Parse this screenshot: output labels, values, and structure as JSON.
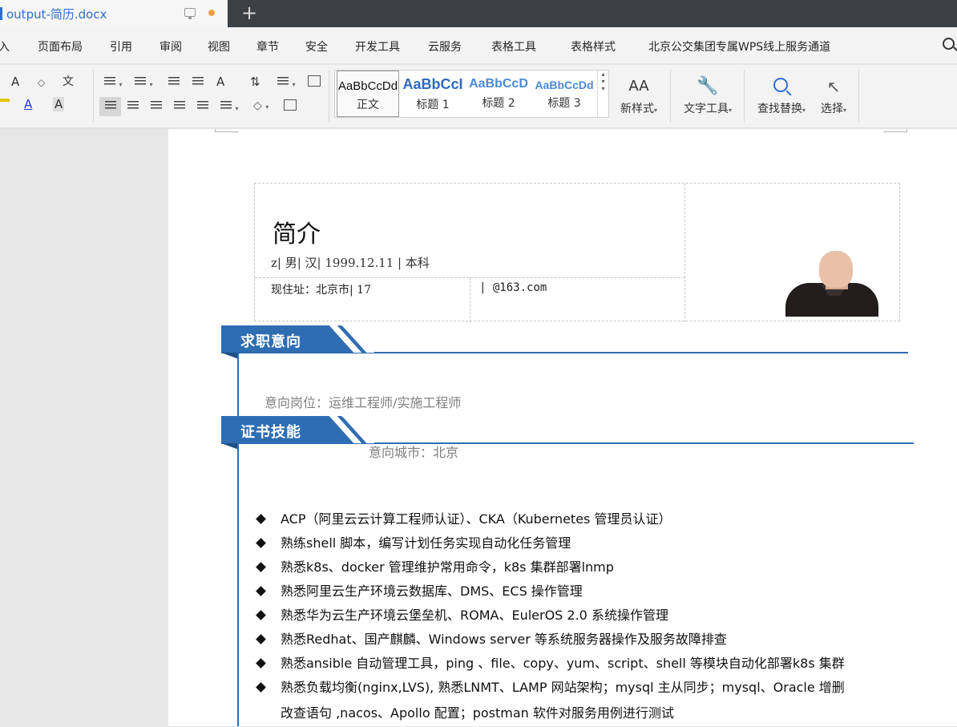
{
  "window": {
    "tab_title": "output-简历.docx",
    "new_tab_symbol": "+"
  },
  "menu": {
    "items": [
      "入",
      "页面布局",
      "引用",
      "审阅",
      "视图",
      "章节",
      "安全",
      "开发工具",
      "云服务",
      "表格工具",
      "表格样式",
      "北京公交集团专属WPS线上服务通道"
    ]
  },
  "ribbon": {
    "font_grow": "A",
    "font_shrink": "A",
    "eraser_symbol": "◇",
    "pinyin": "文",
    "font_color_glyph": "A",
    "char_shade_glyph": "A",
    "text_direction": "A",
    "sort_glyph": "⇅",
    "styles": [
      {
        "sample": "AaBbCcDd",
        "name": "正文"
      },
      {
        "sample": "AaBbCcI",
        "name": "标题 1"
      },
      {
        "sample": "AaBbCcD",
        "name": "标题 2"
      },
      {
        "sample": "AaBbCcDd",
        "name": "标题 3"
      }
    ],
    "new_style": "新样式",
    "new_style_glyph": "AA",
    "text_tools": "文字工具",
    "find_replace": "查找替换",
    "select": "选择",
    "colors": {
      "accent": "#2c6fd6",
      "font_red": "#d92b2b",
      "font_blue": "#1f3fd6"
    }
  },
  "document": {
    "title": "简介",
    "info": "z| 男| 汉| 1999.12.11 | 本科",
    "address": "现住址：北京市| 17",
    "email": "| @163.com",
    "sections": [
      {
        "label": "求职意向"
      },
      {
        "label": "证书技能"
      }
    ],
    "job_position": "意向岗位：运维工程师/实施工程师",
    "job_city": "意向城市：北京",
    "skills": [
      "ACP（阿里云云计算工程师认证）、CKA（Kubernetes 管理员认证）",
      "熟练shell 脚本，编写计划任务实现自动化任务管理",
      "熟悉k8s、docker 管理维护常用命令，k8s 集群部署lnmp",
      "熟悉阿里云生产环境云数据库、DMS、ECS 操作管理",
      "熟悉华为云生产环境云堡垒机、ROMA、EulerOS 2.0 系统操作管理",
      "熟悉Redhat、国产麒麟、Windows server 等系统服务器操作及服务故障排查",
      "熟悉ansible 自动管理工具，ping 、file、copy、yum、script、shell 等模块自动化部署k8s 集群",
      "熟悉负载均衡(nginx,LVS), 熟悉LNMT、LAMP 网站架构；mysql 主从同步；mysql、Oracle 增删"
    ],
    "skill_continuation": "改查语句 ,nacos、Apollo 配置；postman 软件对服务用例进行测试",
    "colors": {
      "section_blue": "#2f6db3"
    }
  }
}
